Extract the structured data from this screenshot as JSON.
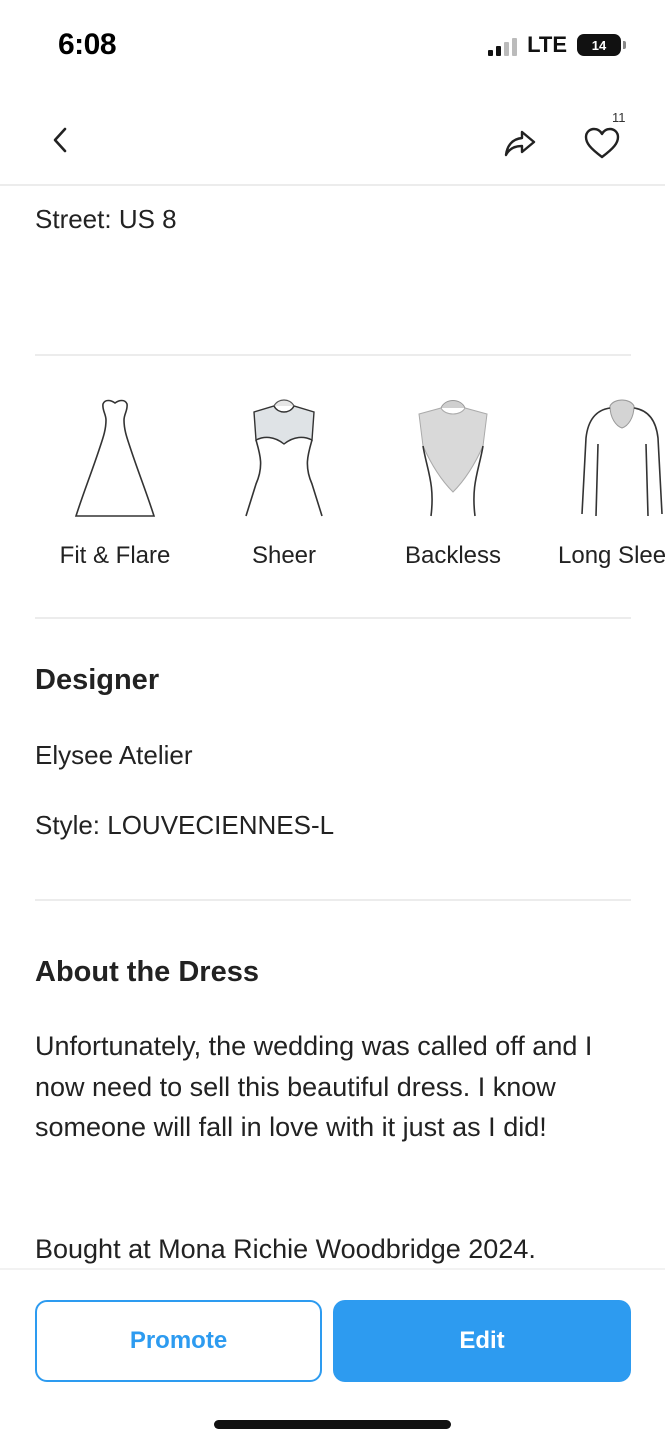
{
  "status": {
    "time": "6:08",
    "network": "LTE",
    "battery": "14"
  },
  "nav": {
    "favorites_count": "11",
    "icons": [
      "chevron-left-icon",
      "share-icon",
      "heart-icon"
    ]
  },
  "size": {
    "street_label": "Street: US 8"
  },
  "features": [
    {
      "label": "Fit & Flare",
      "icon": "fit-flare-silhouette-icon"
    },
    {
      "label": "Sheer",
      "icon": "sheer-bodice-icon"
    },
    {
      "label": "Backless",
      "icon": "backless-bodice-icon"
    },
    {
      "label": "Long Sleeve",
      "icon": "long-sleeve-bodice-icon"
    }
  ],
  "designer": {
    "heading": "Designer",
    "name": "Elysee Atelier",
    "style": "Style: LOUVECIENNES-L"
  },
  "about": {
    "heading": "About the Dress",
    "paragraph1": "Unfortunately, the wedding was called off and I now need to sell this beautiful dress. I know someone will fall in love with it just as I did!",
    "paragraph2": "Bought at Mona Richie Woodbridge 2024."
  },
  "actions": {
    "promote_label": "Promote",
    "edit_label": "Edit"
  },
  "colors": {
    "accent": "#2d9bf0",
    "divider": "#ececec",
    "text": "#222222"
  }
}
